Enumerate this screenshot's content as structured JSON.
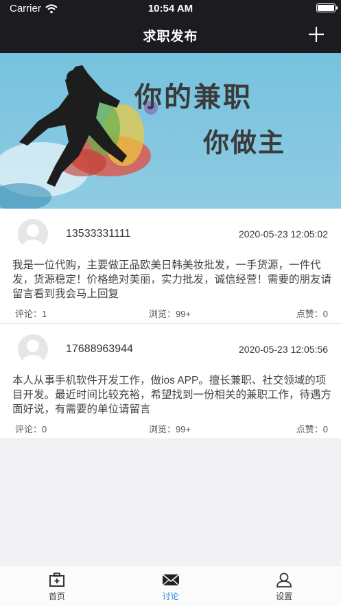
{
  "status_bar": {
    "carrier": "Carrier",
    "time": "10:54 AM"
  },
  "nav": {
    "title": "求职发布"
  },
  "banner": {
    "line1": "你的兼职",
    "line2": "你做主"
  },
  "posts": [
    {
      "phone": "13533331111",
      "date": "2020-05-23 12:05:02",
      "content": "我是一位代购，主要做正品欧美日韩美妆批发，一手货源，一件代发，货源稳定！价格绝对美丽，实力批发，诚信经营！需要的朋友请留言看到我会马上回复",
      "comments": "评论：1",
      "views": "浏览：99+",
      "likes": "点赞：0"
    },
    {
      "phone": "17688963944",
      "date": "2020-05-23 12:05:56",
      "content": "本人从事手机软件开发工作，做ios APP。擅长兼职、社交领域的项目开发。最近时间比较充裕，希望找到一份相关的兼职工作，待遇方面好说，有需要的单位请留言",
      "comments": "评论：0",
      "views": "浏览：99+",
      "likes": "点赞：0"
    }
  ],
  "tabbar": {
    "items": [
      {
        "label": "首页",
        "icon": "medical-kit-icon"
      },
      {
        "label": "讨论",
        "icon": "mail-icon"
      },
      {
        "label": "设置",
        "icon": "person-icon"
      }
    ],
    "active_index": 1,
    "active_color": "#2a8ee0"
  }
}
